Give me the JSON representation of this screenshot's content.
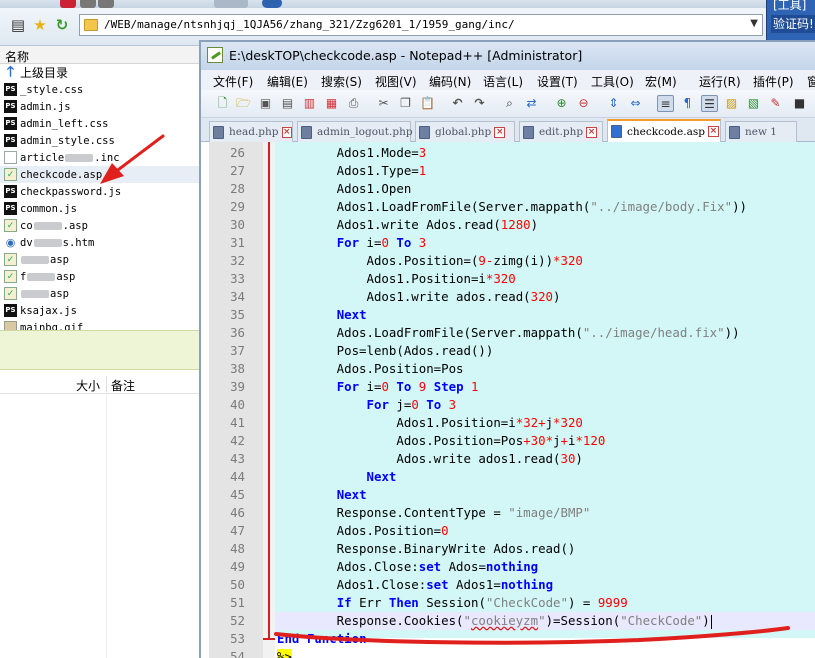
{
  "file_manager": {
    "address_path": "/WEB/manage/ntsnhjqj_1QJA56/zhang_321/Zzg6201_1/1959_gang/inc/",
    "right_strip": {
      "line1": "[工具]",
      "line2": "验证码!",
      "line3": ""
    },
    "header_name": "名称",
    "list_columns": {
      "size": "大小",
      "note": "备注"
    },
    "up_label": "上级目录",
    "files": [
      {
        "name": "_style.css",
        "icon": "ps"
      },
      {
        "name": "admin.js",
        "icon": "ps"
      },
      {
        "name": "admin_left.css",
        "icon": "ps"
      },
      {
        "name": "admin_style.css",
        "icon": "ps"
      },
      {
        "name_prefix": "article",
        "name_suffix": ".inc",
        "icon": "doc",
        "obscured": true
      },
      {
        "name": "checkcode.asp",
        "icon": "asp",
        "selected": true
      },
      {
        "name": "checkpassword.js",
        "icon": "ps"
      },
      {
        "name": "common.js",
        "icon": "ps"
      },
      {
        "name_prefix": "co",
        "name_suffix": ".asp",
        "icon": "asp",
        "obscured": true
      },
      {
        "name_prefix": "dv",
        "name_suffix": "s.htm",
        "icon": "htm",
        "obscured": true
      },
      {
        "name_prefix": "",
        "name_suffix": "asp",
        "icon": "asp",
        "obscured": true
      },
      {
        "name_prefix": "f",
        "name_suffix": "asp",
        "icon": "asp",
        "obscured": true
      },
      {
        "name_prefix": "",
        "name_suffix": "asp",
        "icon": "asp",
        "obscured": true
      },
      {
        "name": "ksajax.js",
        "icon": "ps"
      },
      {
        "name": "mainbg.gif",
        "icon": "img"
      }
    ]
  },
  "notepad": {
    "title": "E:\\deskTOP\\checkcode.asp - Notepad++ [Administrator]",
    "menu": [
      "文件(F)",
      "编辑(E)",
      "搜索(S)",
      "视图(V)",
      "编码(N)",
      "语言(L)",
      "设置(T)",
      "工具(O)",
      "宏(M)",
      "运行(R)",
      "插件(P)",
      "窗口"
    ],
    "tabs": [
      {
        "label": "head.php",
        "active": false
      },
      {
        "label": "admin_logout.php",
        "active": false
      },
      {
        "label": "global.php",
        "active": false
      },
      {
        "label": "edit.php",
        "active": false
      },
      {
        "label": "checkcode.asp",
        "active": true
      },
      {
        "label": "new 1",
        "active": false
      }
    ],
    "code_lines": [
      {
        "n": "26",
        "t": "        Ados1.Mode=3"
      },
      {
        "n": "27",
        "t": "        Ados1.Type=1"
      },
      {
        "n": "28",
        "t": "        Ados1.Open"
      },
      {
        "n": "29",
        "t": "        Ados1.LoadFromFile(Server.mappath(\"../image/body.Fix\"))"
      },
      {
        "n": "30",
        "t": "        Ados1.write Ados.read(1280)"
      },
      {
        "n": "31",
        "t": "        For i=0 To 3"
      },
      {
        "n": "32",
        "t": "            Ados.Position=(9-zimg(i))*320"
      },
      {
        "n": "33",
        "t": "            Ados1.Position=i*320"
      },
      {
        "n": "34",
        "t": "            Ados1.write ados.read(320)"
      },
      {
        "n": "35",
        "t": "        Next"
      },
      {
        "n": "36",
        "t": "        Ados.LoadFromFile(Server.mappath(\"../image/head.fix\"))"
      },
      {
        "n": "37",
        "t": "        Pos=lenb(Ados.read())"
      },
      {
        "n": "38",
        "t": "        Ados.Position=Pos"
      },
      {
        "n": "39",
        "t": "        For i=0 To 9 Step 1"
      },
      {
        "n": "40",
        "t": "            For j=0 To 3"
      },
      {
        "n": "41",
        "t": "                Ados1.Position=i*32+j*320"
      },
      {
        "n": "42",
        "t": "                Ados.Position=Pos+30*j+i*120"
      },
      {
        "n": "43",
        "t": "                Ados.write ados1.read(30)"
      },
      {
        "n": "44",
        "t": "            Next"
      },
      {
        "n": "45",
        "t": "        Next"
      },
      {
        "n": "46",
        "t": "        Response.ContentType = \"image/BMP\""
      },
      {
        "n": "47",
        "t": "        Ados.Position=0"
      },
      {
        "n": "48",
        "t": "        Response.BinaryWrite Ados.read()"
      },
      {
        "n": "49",
        "t": "        Ados.Close:set Ados=nothing"
      },
      {
        "n": "50",
        "t": "        Ados1.Close:set Ados1=nothing"
      },
      {
        "n": "51",
        "t": "        If Err Then Session(\"CheckCode\") = 9999"
      },
      {
        "n": "52",
        "t": "        Response.Cookies(\"cookieyzm\")=Session(\"CheckCode\")"
      },
      {
        "n": "53",
        "t": "End Function"
      },
      {
        "n": "54",
        "t": "%>"
      }
    ],
    "current_line": "52"
  },
  "colors": {
    "keyword": "#0000ff",
    "number": "#ff0000",
    "string": "#808080",
    "code_background": "#d3f7f7",
    "annotation_red": "#e0201c"
  }
}
